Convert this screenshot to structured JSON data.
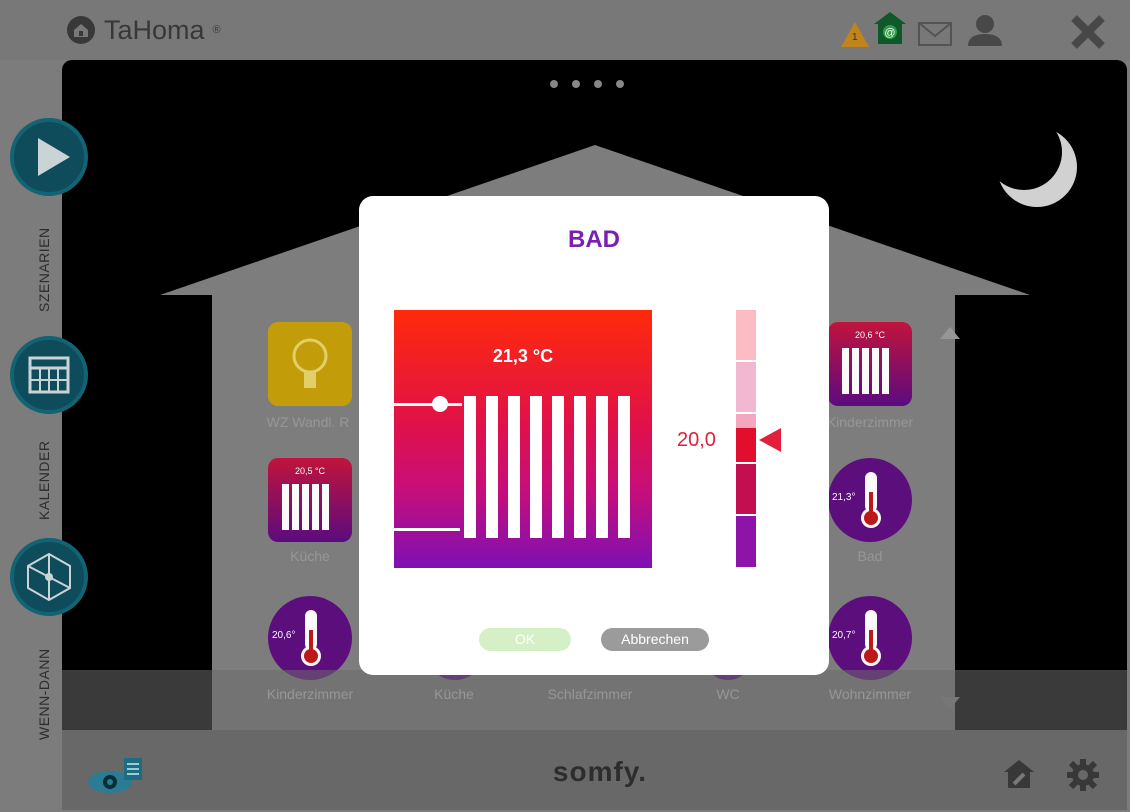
{
  "app": {
    "brand": "TaHoma",
    "brand_mark": "®",
    "footer_brand": "somfy."
  },
  "topbar": {
    "icons": [
      "warning-icon",
      "home-internet-icon",
      "mail-icon",
      "user-icon",
      "close-icon"
    ],
    "warning_count": "1"
  },
  "sidebar": {
    "items": [
      {
        "label": "SZENARIEN",
        "icon": "play-icon"
      },
      {
        "label": "KALENDER",
        "icon": "calendar-icon"
      },
      {
        "label": "WENN-DANN",
        "icon": "network-icon"
      }
    ]
  },
  "devices": [
    {
      "label": "WZ Wandl. R",
      "type": "light"
    },
    {
      "label": "Kinderzimmer",
      "type": "heater",
      "value": "20,6 °C"
    },
    {
      "label": "Küche",
      "type": "heater",
      "value": "20,5 °C"
    },
    {
      "label": "Bad",
      "type": "thermometer",
      "value": "21,3°"
    },
    {
      "label": "Kinderzimmer",
      "type": "thermometer",
      "value": "20,6°"
    },
    {
      "label": "Küche",
      "type": "thermometer"
    },
    {
      "label": "Schlafzimmer",
      "type": "thermometer"
    },
    {
      "label": "WC",
      "type": "thermometer"
    },
    {
      "label": "Wohnzimmer",
      "type": "thermometer",
      "value": "20,7°"
    }
  ],
  "dialog": {
    "title": "BAD",
    "current_temp": "21,3 °C",
    "setpoint": "20,0",
    "ok_label": "OK",
    "cancel_label": "Abbrechen"
  },
  "colors": {
    "accent": "#7a1fb0",
    "setpoint": "#e1203a",
    "ok": "#cfeebc",
    "cancel": "#999999"
  }
}
